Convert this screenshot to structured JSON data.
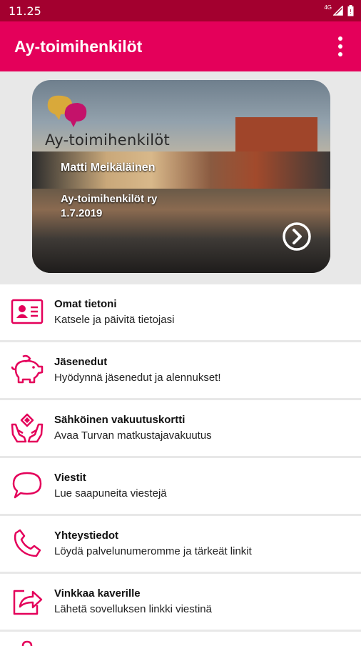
{
  "status": {
    "time": "11.25",
    "network": "4G"
  },
  "appbar": {
    "title": "Ay-toimihenkilöt",
    "menu_icon": "more-vert-icon"
  },
  "card": {
    "logo_text": "Ay-toimihenkilöt",
    "member_name": "Matti Meikäläinen",
    "organization": "Ay-toimihenkilöt ry",
    "date": "1.7.2019",
    "accent_color": "#e4005a"
  },
  "menu": {
    "items": [
      {
        "title": "Omat tietoni",
        "subtitle": "Katsele ja päivitä tietojasi",
        "icon": "id-card-icon"
      },
      {
        "title": "Jäsenedut",
        "subtitle": "Hyödynnä jäsenedut ja alennukset!",
        "icon": "piggy-bank-icon"
      },
      {
        "title": "Sähköinen vakuutuskortti",
        "subtitle": "Avaa Turvan matkustajavakuutus",
        "icon": "insurance-hands-icon"
      },
      {
        "title": "Viestit",
        "subtitle": "Lue saapuneita viestejä",
        "icon": "chat-bubble-icon"
      },
      {
        "title": "Yhteystiedot",
        "subtitle": "Löydä palvelunumeromme ja tärkeät linkit",
        "icon": "phone-icon"
      },
      {
        "title": "Vinkkaa kaverille",
        "subtitle": "Lähetä sovelluksen linkki viestinä",
        "icon": "share-icon"
      }
    ]
  },
  "colors": {
    "primary": "#e4005a",
    "status_bar": "#a3002f",
    "background": "#e8e8e8"
  }
}
